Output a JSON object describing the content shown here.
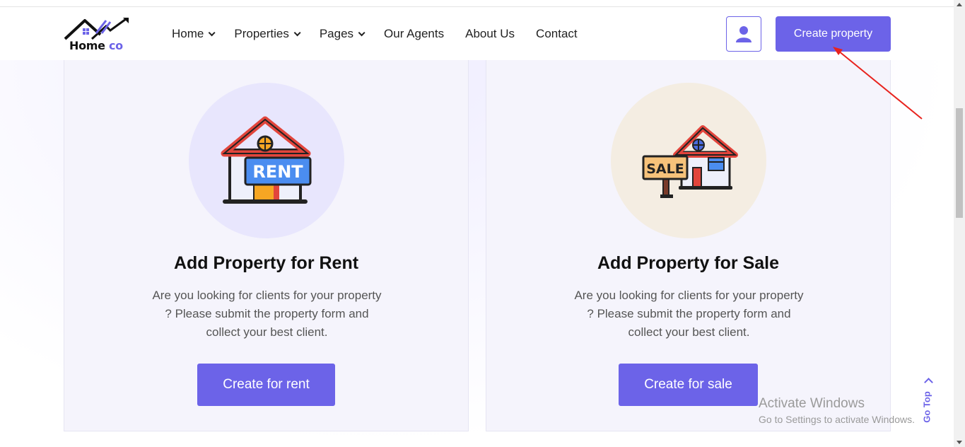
{
  "brand": {
    "logo_text_home": "Home",
    "logo_text_co": "co",
    "accent": "#6c63e8"
  },
  "nav": {
    "items": [
      {
        "label": "Home",
        "dropdown": true
      },
      {
        "label": "Properties",
        "dropdown": true
      },
      {
        "label": "Pages",
        "dropdown": true
      },
      {
        "label": "Our Agents",
        "dropdown": false
      },
      {
        "label": "About Us",
        "dropdown": false
      },
      {
        "label": "Contact",
        "dropdown": false
      }
    ]
  },
  "header": {
    "user_icon": "user-icon",
    "create_button": "Create property"
  },
  "cards": [
    {
      "icon": "house-rent-sign-icon",
      "sign_text": "RENT",
      "title": "Add Property for Rent",
      "desc_lines": [
        "Are you looking for clients for your property",
        "? Please submit the property form and",
        "collect your best client."
      ],
      "button": "Create for rent"
    },
    {
      "icon": "house-sale-sign-icon",
      "sign_text": "SALE",
      "title": "Add Property for Sale",
      "desc_lines": [
        "Are you looking for clients for your property",
        "? Please submit the property form and",
        "collect your best client."
      ],
      "button": "Create for sale"
    }
  ],
  "go_top": "Go Top",
  "watermark": {
    "line1": "Activate Windows",
    "line2": "Go to Settings to activate Windows."
  }
}
